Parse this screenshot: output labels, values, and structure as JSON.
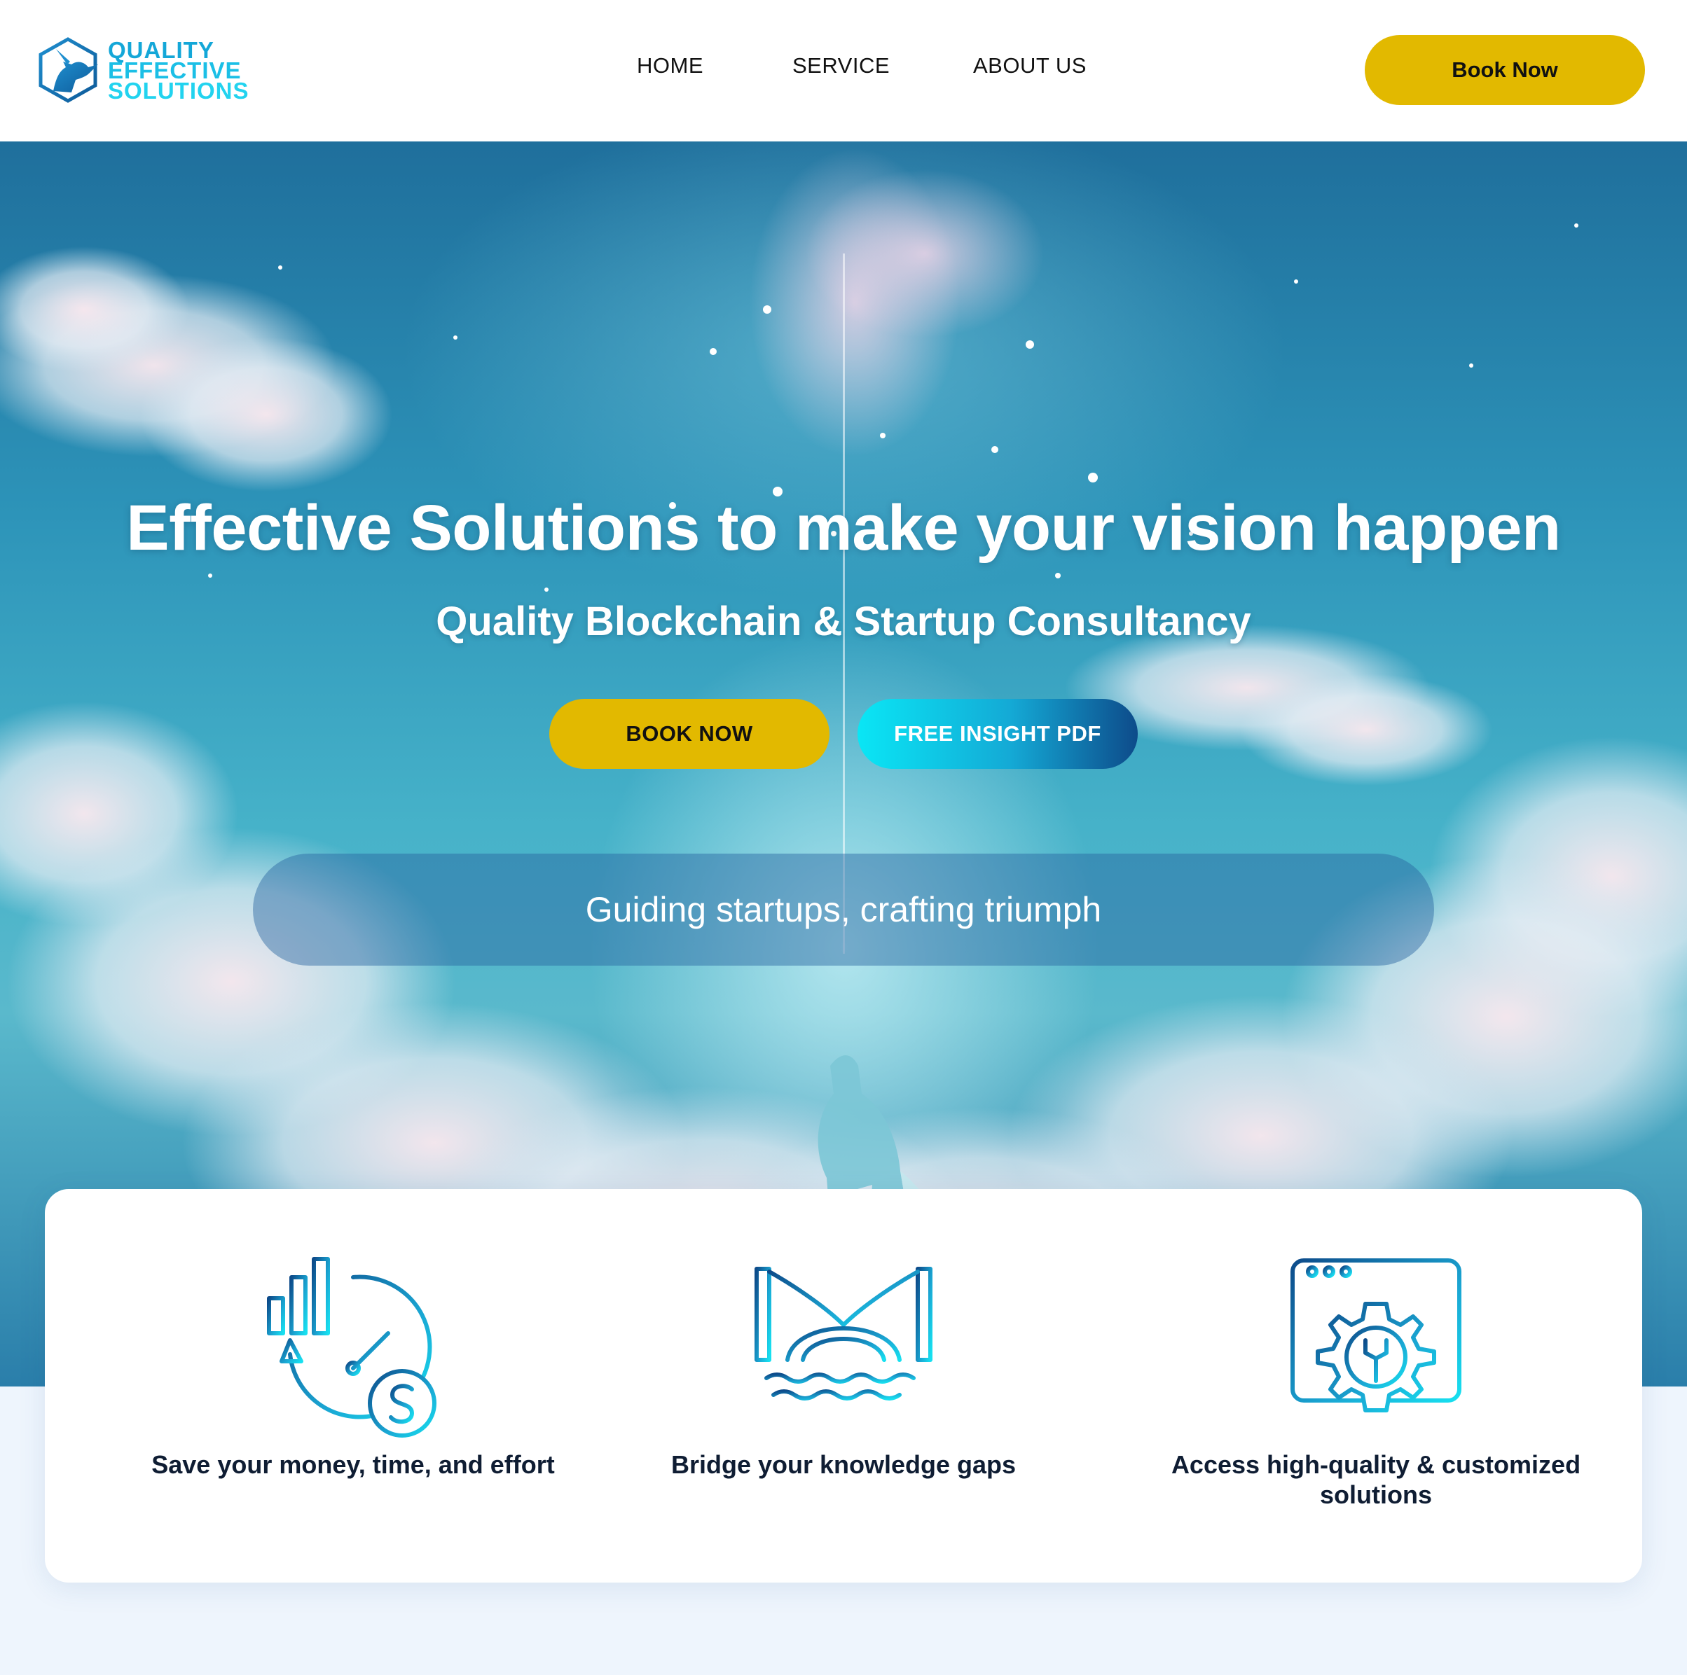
{
  "header": {
    "logo": {
      "line1": "QUALITY",
      "line2": "EFFECTIVE",
      "line3": "SOLUTIONS",
      "icon": "unicorn-hexagon-logo"
    },
    "nav": [
      {
        "label": "HOME"
      },
      {
        "label": "SERVICE"
      },
      {
        "label": "ABOUT US"
      }
    ],
    "book_now_label": "Book Now"
  },
  "hero": {
    "title": "Effective Solutions to make your vision happen",
    "subtitle": "Quality Blockchain & Startup Consultancy",
    "book_button_label": "BOOK NOW",
    "pdf_button_label": "FREE INSIGHT PDF",
    "tagline": "Guiding startups, crafting triumph"
  },
  "features": [
    {
      "label": "Save your money, time, and effort",
      "icon": "clock-chart-dollar-icon"
    },
    {
      "label": "Bridge your knowledge gaps",
      "icon": "bridge-icon"
    },
    {
      "label": "Access high-quality & customized solutions",
      "icon": "browser-gear-wrench-icon"
    }
  ],
  "colors": {
    "accent_yellow": "#e2b900",
    "brand_cyan": "#14a7d8",
    "brand_navy": "#0d4b8a",
    "text_dark": "#0f1d33"
  }
}
